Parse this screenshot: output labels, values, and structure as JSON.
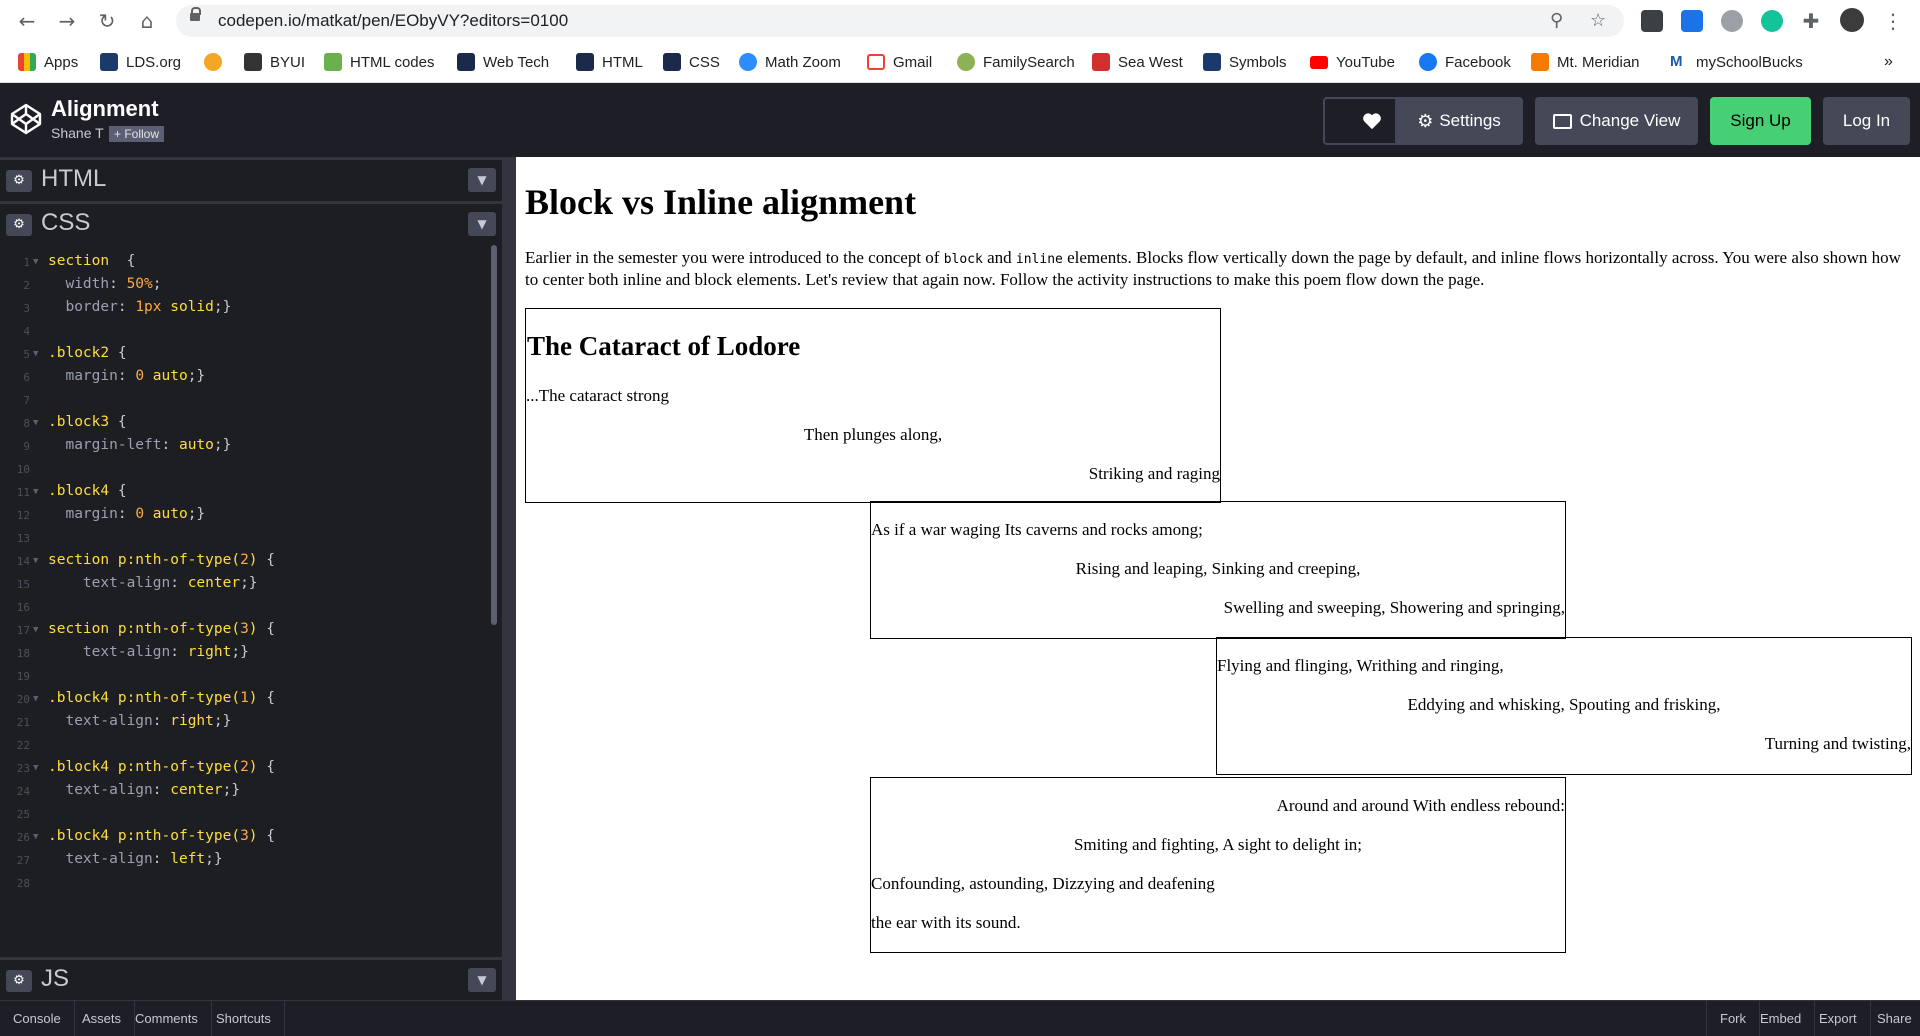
{
  "browser": {
    "url": "codepen.io/matkat/pen/EObyVY?editors=0100",
    "bookmarks": [
      "Apps",
      "LDS.org",
      "",
      "BYUI",
      "HTML codes",
      "Web Tech",
      "HTML",
      "CSS",
      "Math Zoom",
      "Gmail",
      "FamilySearch",
      "Sea West",
      "Symbols",
      "YouTube",
      "Facebook",
      "Mt. Meridian",
      "mySchoolBucks"
    ],
    "more_label": "»"
  },
  "header": {
    "title": "Alignment",
    "author": "Shane T",
    "follow_label": "+ Follow",
    "settings_label": "Settings",
    "change_view_label": "Change View",
    "signup_label": "Sign Up",
    "login_label": "Log In",
    "colors": {
      "bg": "#1e1f26",
      "signup": "#47cf73",
      "button": "#444857"
    }
  },
  "editor": {
    "html_label": "HTML",
    "css_label": "CSS",
    "js_label": "JS",
    "css_lines": [
      [
        [
          "sel",
          "section"
        ],
        [
          "",
          "  {"
        ]
      ],
      [
        [
          "prop",
          "  width"
        ],
        [
          "",
          ": "
        ],
        [
          "num",
          "50%"
        ],
        [
          "",
          ";"
        ]
      ],
      [
        [
          "prop",
          "  border"
        ],
        [
          "",
          ": "
        ],
        [
          "num",
          "1px"
        ],
        [
          "kw",
          " solid"
        ],
        [
          "",
          ";}"
        ]
      ],
      [],
      [
        [
          "sel",
          ".block2"
        ],
        [
          "",
          " {"
        ]
      ],
      [
        [
          "prop",
          "  margin"
        ],
        [
          "",
          ": "
        ],
        [
          "num",
          "0"
        ],
        [
          "kw",
          " auto"
        ],
        [
          "",
          ";}"
        ]
      ],
      [],
      [
        [
          "sel",
          ".block3"
        ],
        [
          "",
          " {"
        ]
      ],
      [
        [
          "prop",
          "  margin-left"
        ],
        [
          "",
          ": "
        ],
        [
          "kw",
          "auto"
        ],
        [
          "",
          ";}"
        ]
      ],
      [],
      [
        [
          "sel",
          ".block4"
        ],
        [
          "",
          " {"
        ]
      ],
      [
        [
          "prop",
          "  margin"
        ],
        [
          "",
          ": "
        ],
        [
          "num",
          "0"
        ],
        [
          "kw",
          " auto"
        ],
        [
          "",
          ";}"
        ]
      ],
      [],
      [
        [
          "sel",
          "section p:nth-of-type("
        ],
        [
          "num",
          "2"
        ],
        [
          "sel",
          ")"
        ],
        [
          "",
          " {"
        ]
      ],
      [
        [
          "prop",
          "    text-align"
        ],
        [
          "",
          ": "
        ],
        [
          "kw",
          "center"
        ],
        [
          "",
          ";}"
        ]
      ],
      [],
      [
        [
          "sel",
          "section p:nth-of-type("
        ],
        [
          "num",
          "3"
        ],
        [
          "sel",
          ")"
        ],
        [
          "",
          " {"
        ]
      ],
      [
        [
          "prop",
          "    text-align"
        ],
        [
          "",
          ": "
        ],
        [
          "kw",
          "right"
        ],
        [
          "",
          ";}"
        ]
      ],
      [],
      [
        [
          "sel",
          ".block4 p:nth-of-type("
        ],
        [
          "num",
          "1"
        ],
        [
          "sel",
          ")"
        ],
        [
          "",
          " {"
        ]
      ],
      [
        [
          "prop",
          "  text-align"
        ],
        [
          "",
          ": "
        ],
        [
          "kw",
          "right"
        ],
        [
          "",
          ";}"
        ]
      ],
      [],
      [
        [
          "sel",
          ".block4 p:nth-of-type("
        ],
        [
          "num",
          "2"
        ],
        [
          "sel",
          ")"
        ],
        [
          "",
          " {"
        ]
      ],
      [
        [
          "prop",
          "  text-align"
        ],
        [
          "",
          ": "
        ],
        [
          "kw",
          "center"
        ],
        [
          "",
          ";}"
        ]
      ],
      [],
      [
        [
          "sel",
          ".block4 p:nth-of-type("
        ],
        [
          "num",
          "3"
        ],
        [
          "sel",
          ")"
        ],
        [
          "",
          " {"
        ]
      ],
      [
        [
          "prop",
          "  text-align"
        ],
        [
          "",
          ": "
        ],
        [
          "kw",
          "left"
        ],
        [
          "",
          ";}"
        ]
      ],
      []
    ]
  },
  "footer": {
    "left": [
      "Console",
      "Assets",
      "Comments",
      "Shortcuts"
    ],
    "right": [
      "Fork",
      "Embed",
      "Export",
      "Share"
    ]
  },
  "preview": {
    "heading": "Block vs Inline alignment",
    "intro_before": "Earlier in the semester you were introduced to the concept of ",
    "intro_code1": "block",
    "intro_mid": " and ",
    "intro_code2": "inline",
    "intro_after": " elements. Blocks flow vertically down the page by default, and inline flows horizontally across. You were also shown how to center both inline and block elements. Let's review that again now. Follow the activity instructions to make this poem flow down the page.",
    "poem_title": "The Cataract of Lodore",
    "block1": [
      "...The cataract strong",
      "Then plunges along,",
      "Striking and raging"
    ],
    "block2": [
      "As if a war waging Its caverns and rocks among;",
      "Rising and leaping, Sinking and creeping,",
      "Swelling and sweeping, Showering and springing,"
    ],
    "block3": [
      "Flying and flinging, Writhing and ringing,",
      "Eddying and whisking, Spouting and frisking,",
      "Turning and twisting,"
    ],
    "block4": [
      "Around and around With endless rebound:",
      "Smiting and fighting, A sight to delight in;",
      "Confounding, astounding, Dizzying and deafening",
      "the ear with its sound."
    ]
  }
}
